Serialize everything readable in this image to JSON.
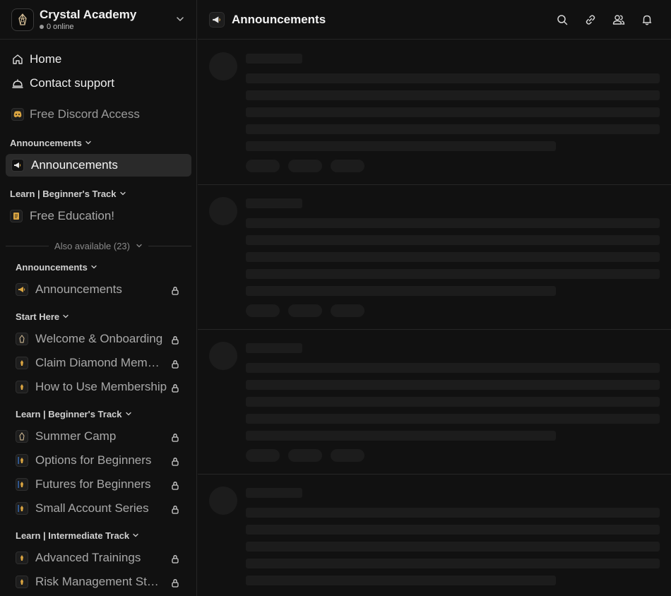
{
  "workspace": {
    "name": "Crystal Academy",
    "online": "0 online"
  },
  "nav": {
    "home": "Home",
    "contact": "Contact support",
    "discord": "Free Discord Access"
  },
  "sections": {
    "announcements": "Announcements",
    "active_channel": "Announcements",
    "learn_beginner": "Learn | Beginner's Track",
    "free_education": "Free Education!",
    "also_available": "Also available (23)"
  },
  "locked": {
    "announcements_section": "Announcements",
    "announcements_channel": "Announcements",
    "start_here": "Start Here",
    "welcome": "Welcome & Onboarding",
    "claim": "Claim Diamond Membership",
    "howto": "How to Use Membership",
    "learn_beginner": "Learn | Beginner's Track",
    "summer": "Summer Camp",
    "options": "Options for Beginners",
    "futures": "Futures for Beginners",
    "small": "Small Account Series",
    "learn_intermediate": "Learn | Intermediate Track",
    "advanced": "Advanced Trainings",
    "risk": "Risk Management Strategies"
  },
  "main": {
    "title": "Announcements"
  },
  "colors": {
    "background": "#111111",
    "active_item": "#2a2a2a",
    "skeleton": "#1c1c1c",
    "gold_icon": "#d9a441"
  }
}
